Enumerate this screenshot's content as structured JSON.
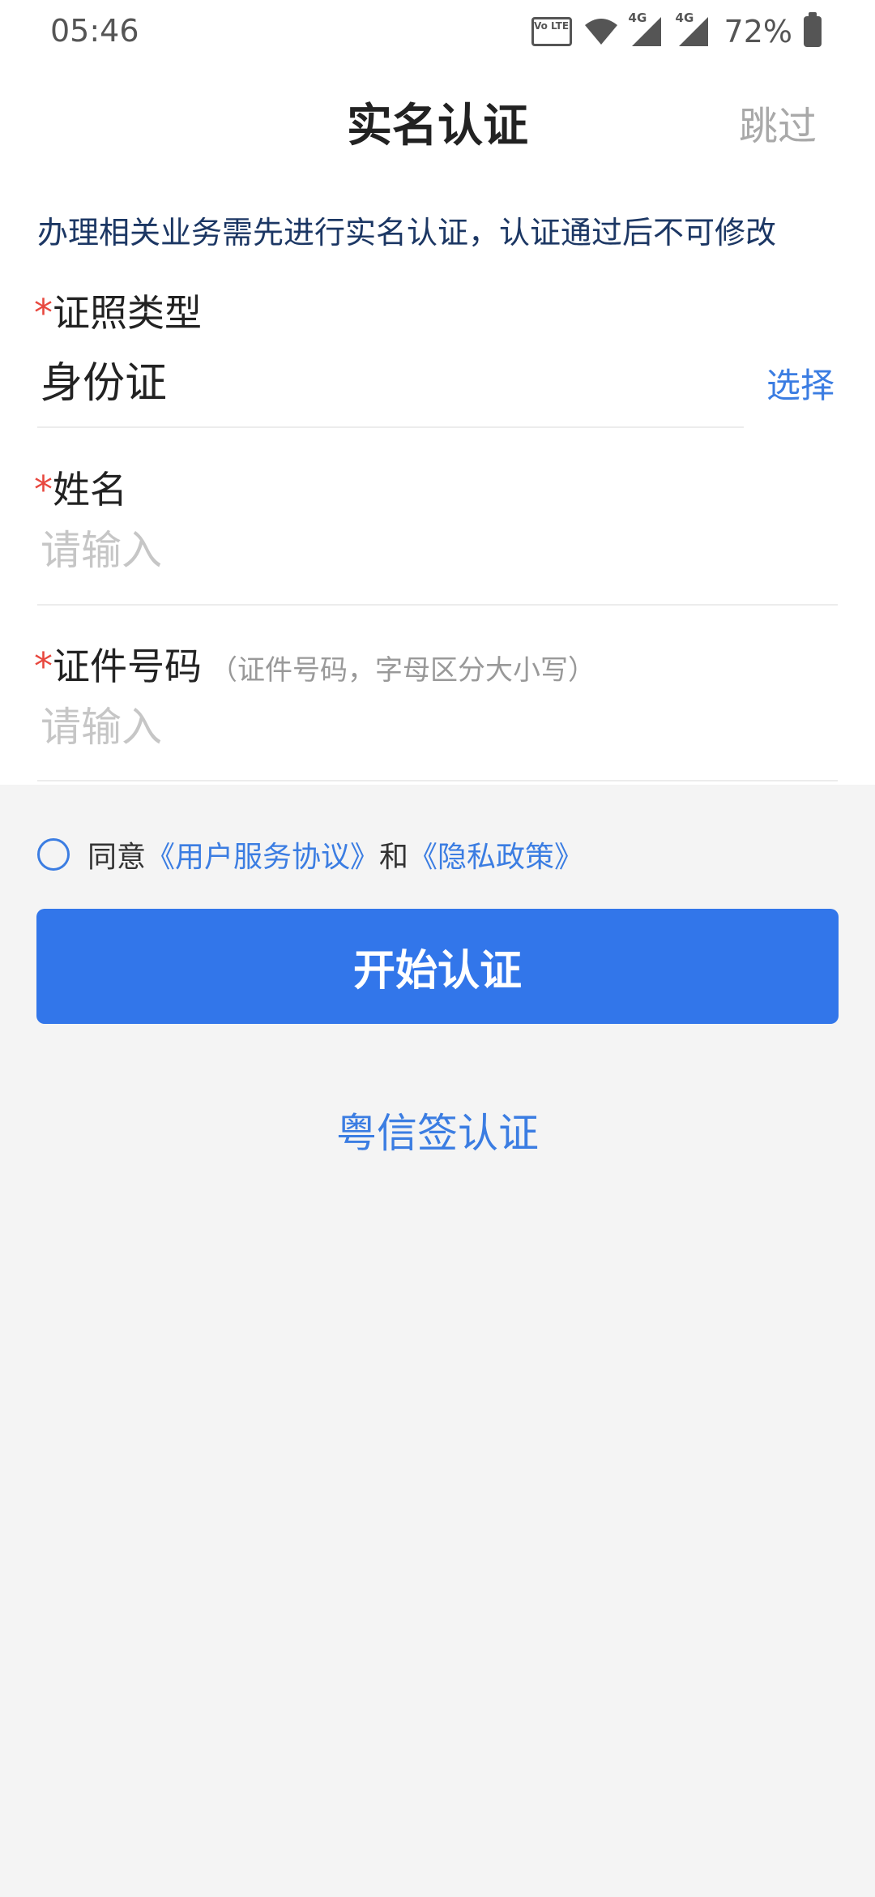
{
  "status_bar": {
    "time": "05:46",
    "volte": "Vo LTE",
    "network_1": "4G",
    "network_2": "4G",
    "battery": "72%"
  },
  "header": {
    "title": "实名认证",
    "skip_label": "跳过"
  },
  "notice": "办理相关业务需先进行实名认证，认证通过后不可修改",
  "form": {
    "required_mark": "*",
    "id_type": {
      "label": "证照类型",
      "value": "身份证",
      "select_label": "选择"
    },
    "name": {
      "label": "姓名",
      "placeholder": "请输入"
    },
    "id_number": {
      "label": "证件号码",
      "hint": "（证件号码，字母区分大小写）",
      "placeholder": "请输入"
    }
  },
  "agreement": {
    "prefix": "同意",
    "user_agreement": "《用户服务协议》",
    "and": "和",
    "privacy_policy": "《隐私政策》",
    "checked": false
  },
  "start_button_label": "开始认证",
  "alt_auth_link": "粤信签认证",
  "colors": {
    "accent": "#3276ea",
    "link": "#3b7de2",
    "required": "#e8483f"
  }
}
